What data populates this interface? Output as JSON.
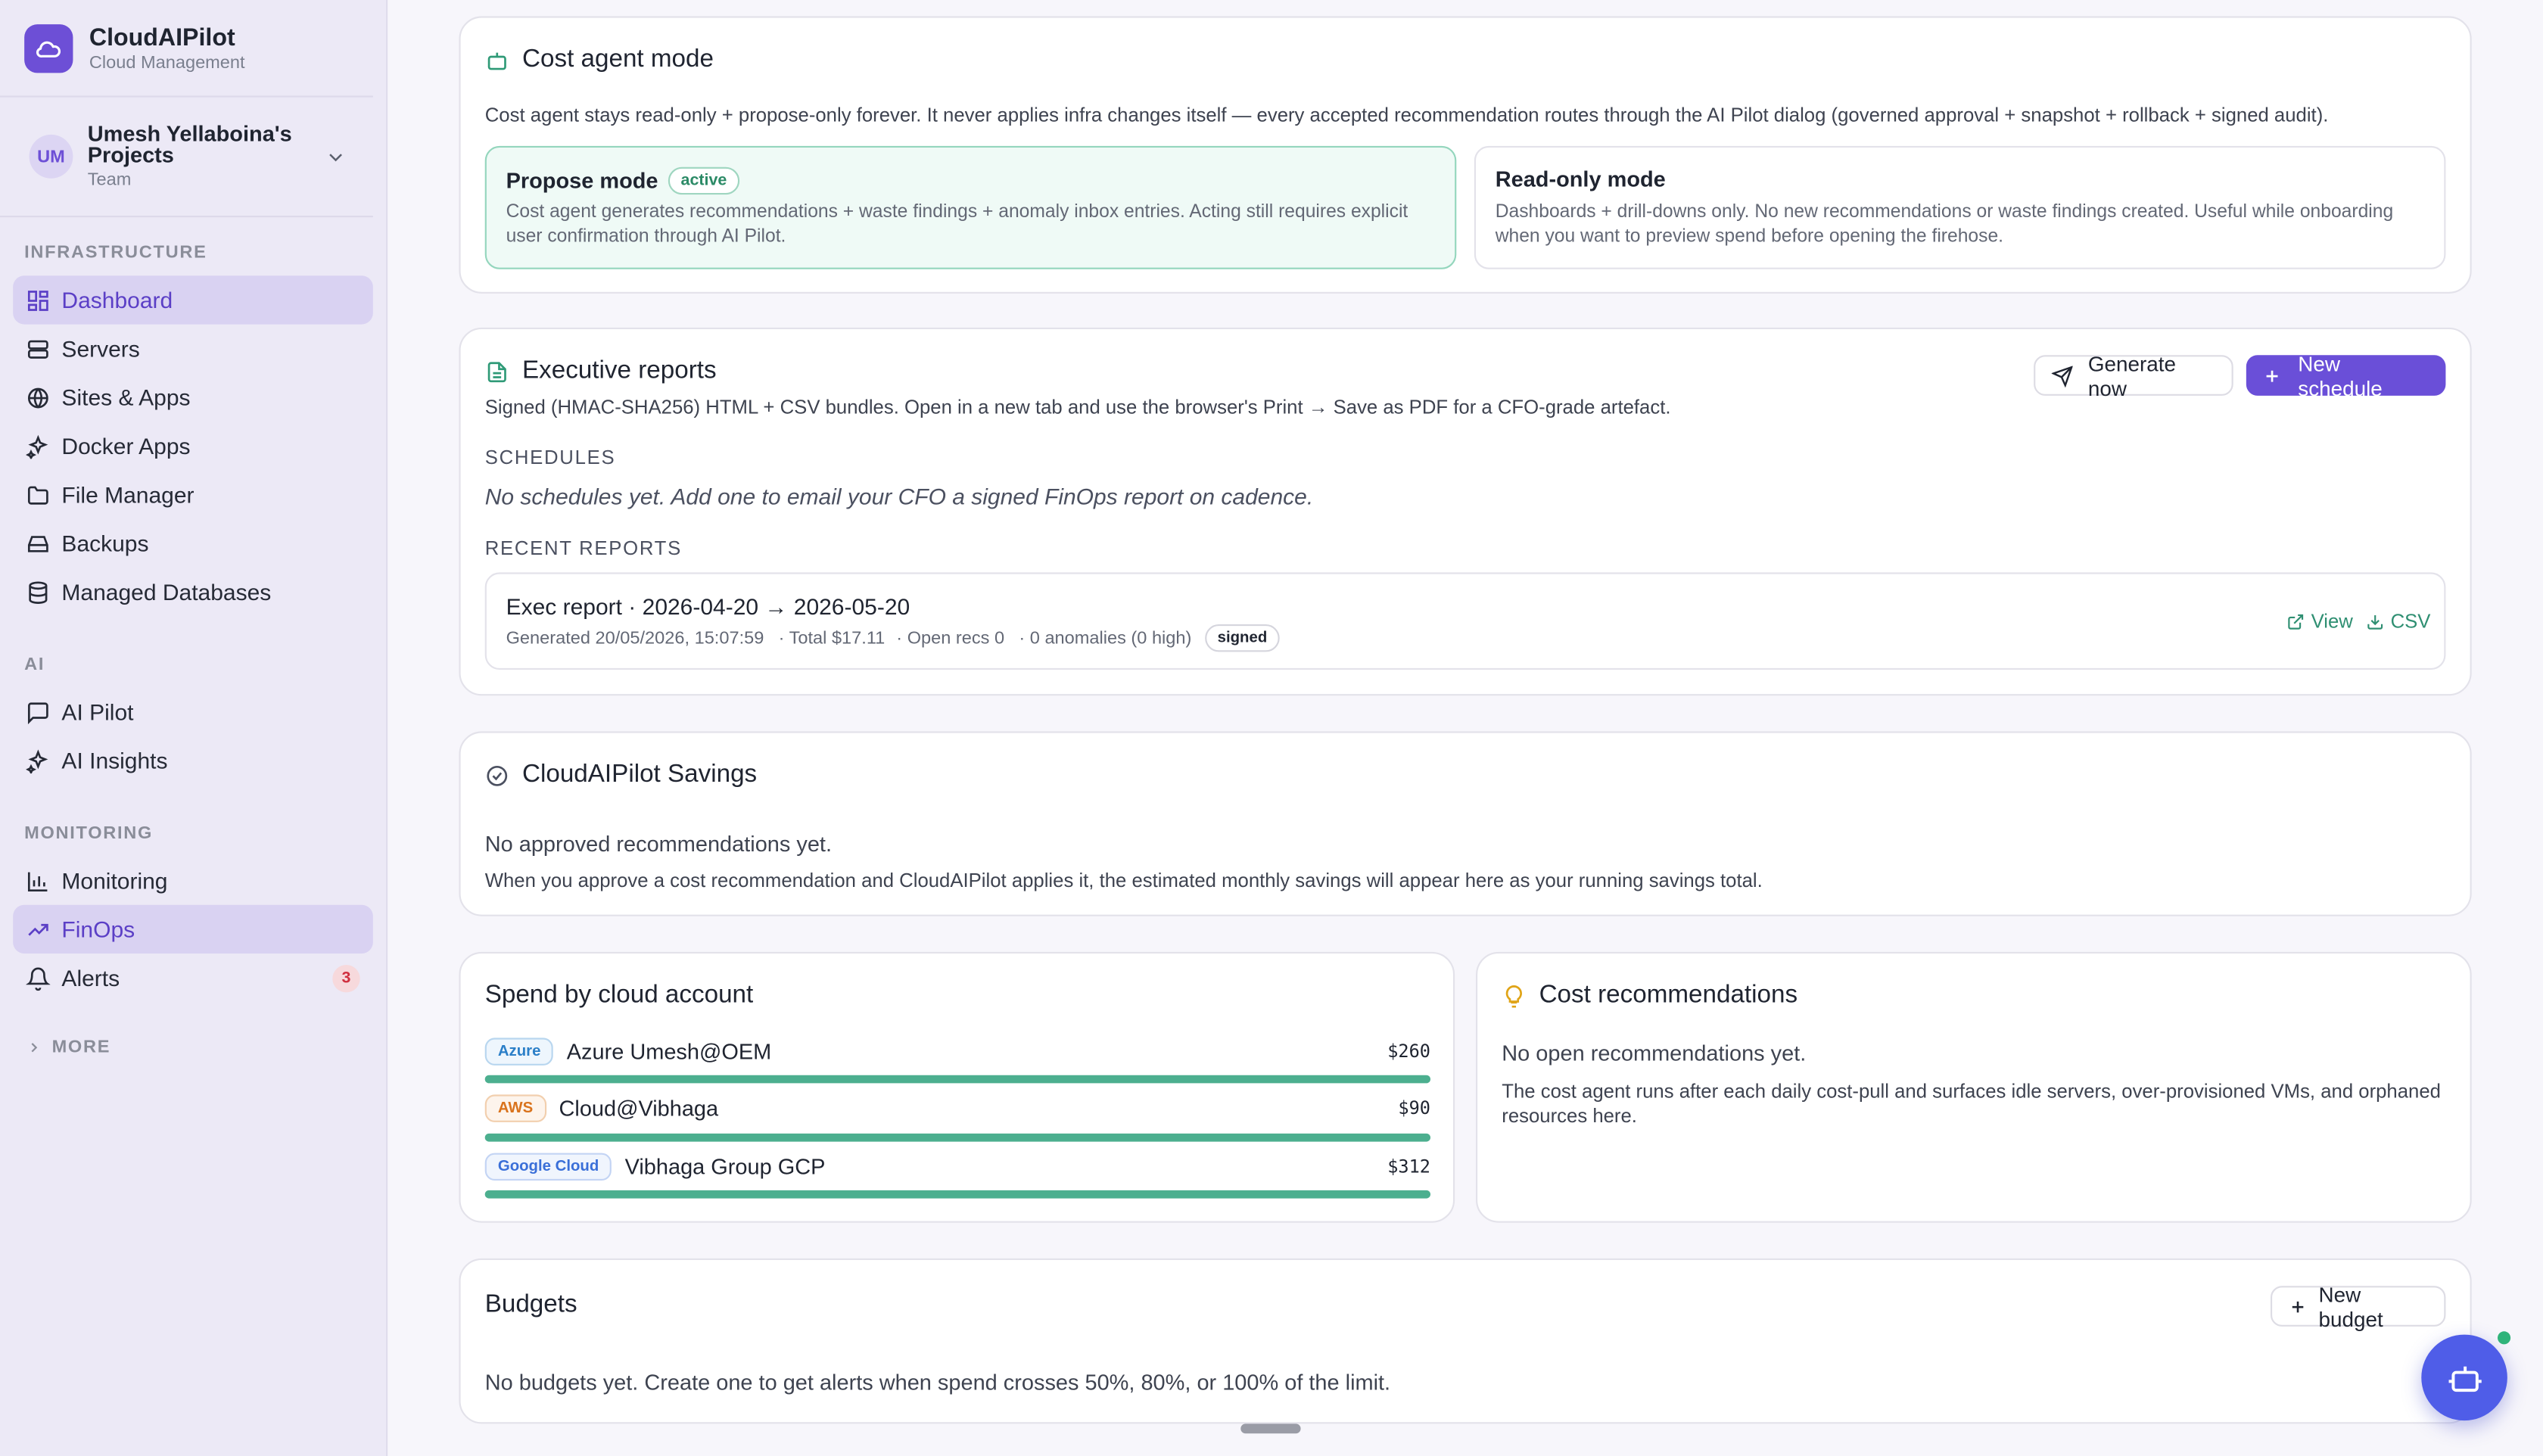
{
  "brand": {
    "name": "CloudAIPilot",
    "subtitle": "Cloud Management"
  },
  "project": {
    "initials": "UM",
    "name": "Umesh Yellaboina's Projects",
    "type": "Team"
  },
  "sidebar": {
    "sections": [
      {
        "label": "INFRASTRUCTURE",
        "items": [
          "Dashboard",
          "Servers",
          "Sites & Apps",
          "Docker Apps",
          "File Manager",
          "Backups",
          "Managed Databases"
        ]
      },
      {
        "label": "AI",
        "items": [
          "AI Pilot",
          "AI Insights"
        ]
      },
      {
        "label": "MONITORING",
        "items": [
          "Monitoring",
          "FinOps",
          "Alerts"
        ]
      }
    ],
    "alerts_count": "3",
    "more_label": "MORE"
  },
  "cost_agent": {
    "title": "Cost agent mode",
    "description": "Cost agent stays read-only + propose-only forever. It never applies infra changes itself — every accepted recommendation routes through the AI Pilot dialog (governed approval + snapshot + rollback + signed audit).",
    "propose": {
      "title": "Propose mode",
      "badge": "active",
      "text": "Cost agent generates recommendations + waste findings + anomaly inbox entries. Acting still requires explicit user confirmation through AI Pilot."
    },
    "readonly": {
      "title": "Read-only mode",
      "text": "Dashboards + drill-downs only. No new recommendations or waste findings created. Useful while onboarding when you want to preview spend before opening the firehose."
    }
  },
  "exec_reports": {
    "title": "Executive reports",
    "description": "Signed (HMAC-SHA256) HTML + CSV bundles. Open in a new tab and use the browser's Print → Save as PDF for a CFO-grade artefact.",
    "generate_label": "Generate now",
    "schedule_label": "New schedule",
    "schedules_label": "SCHEDULES",
    "schedules_empty": "No schedules yet. Add one to email your CFO a signed FinOps report on cadence.",
    "recent_label": "RECENT REPORTS",
    "report": {
      "title": "Exec report · 2026-04-20 → 2026-05-20",
      "generated": "Generated 20/05/2026, 15:07:59",
      "total": "· Total $17.11",
      "open_recs": "· Open recs 0",
      "anomalies": "· 0 anomalies (0 high)",
      "badge": "signed",
      "view_label": "View",
      "csv_label": "CSV"
    }
  },
  "savings": {
    "title": "CloudAIPilot Savings",
    "empty": "No approved recommendations yet.",
    "text": "When you approve a cost recommendation and CloudAIPilot applies it, the estimated monthly savings will appear here as your running savings total."
  },
  "spend": {
    "title": "Spend by cloud account",
    "accounts": [
      {
        "provider": "Azure",
        "name": "Azure Umesh@OEM",
        "amount": "$260",
        "color": "#2b7fc8"
      },
      {
        "provider": "AWS",
        "name": "Cloud@Vibhaga",
        "amount": "$90",
        "color": "#d9731d"
      },
      {
        "provider": "Google Cloud",
        "name": "Vibhaga Group GCP",
        "amount": "$312",
        "color": "#3a6fd8"
      }
    ]
  },
  "recommendations": {
    "title": "Cost recommendations",
    "empty": "No open recommendations yet.",
    "text": "The cost agent runs after each daily cost-pull and surfaces idle servers, over-provisioned VMs, and orphaned resources here."
  },
  "budgets": {
    "title": "Budgets",
    "new_label": "New budget",
    "empty": "No budgets yet. Create one to get alerts when spend crosses 50%, 80%, or 100% of the limit."
  },
  "colors": {
    "accent": "#6a4fd8",
    "success": "#4caf8f",
    "sidebar": "#ece9f6"
  }
}
